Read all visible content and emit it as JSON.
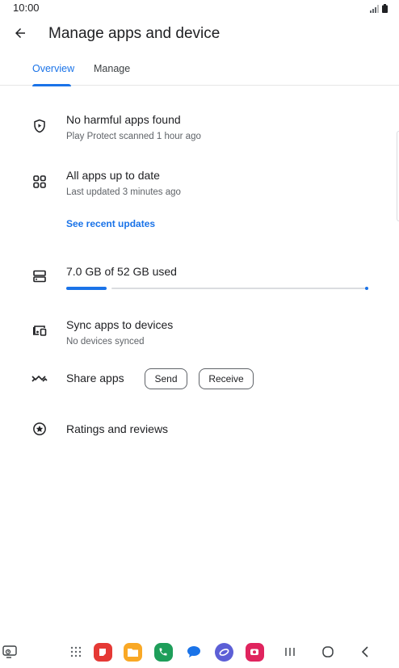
{
  "status_bar": {
    "time": "10:00"
  },
  "app_bar": {
    "title": "Manage apps and device"
  },
  "tabs": [
    {
      "label": "Overview",
      "active": true
    },
    {
      "label": "Manage",
      "active": false
    }
  ],
  "protect": {
    "title": "No harmful apps found",
    "subtitle": "Play Protect scanned 1 hour ago",
    "icon": "shield-play-icon"
  },
  "updates": {
    "title": "All apps up to date",
    "subtitle": "Last updated 3 minutes ago",
    "link": "See recent updates",
    "icon": "apps-grid-icon"
  },
  "storage": {
    "title": "7.0 GB of 52 GB used",
    "used_gb": 7.0,
    "total_gb": 52,
    "icon": "storage-icon"
  },
  "sync": {
    "title": "Sync apps to devices",
    "subtitle": "No devices synced",
    "icon": "devices-icon"
  },
  "share": {
    "title": "Share apps",
    "send_label": "Send",
    "receive_label": "Receive",
    "icon": "share-apps-icon"
  },
  "ratings": {
    "title": "Ratings and reviews",
    "icon": "star-circle-icon"
  },
  "nav_bar": {
    "items": [
      "screen-edge-icon",
      "app-drawer-icon",
      "red-app-icon",
      "files-icon",
      "phone-icon",
      "messages-icon",
      "internet-icon",
      "camera-icon",
      "recents-icon",
      "home-icon",
      "back-icon"
    ]
  },
  "colors": {
    "accent": "#1a73e8",
    "text": "#202124",
    "secondary": "#5f6368"
  }
}
